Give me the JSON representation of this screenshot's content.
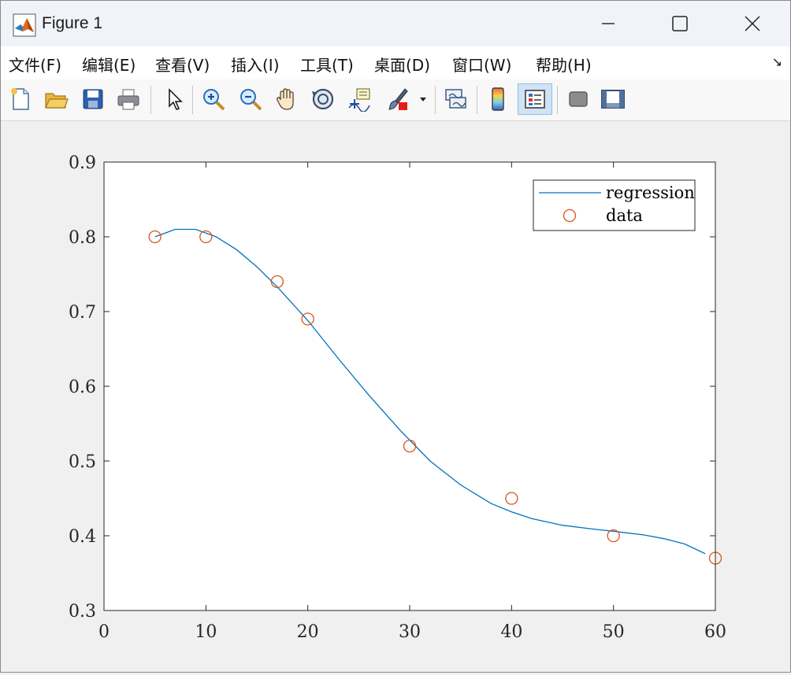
{
  "window": {
    "title": "Figure 1"
  },
  "menu": [
    "文件(F)",
    "编辑(E)",
    "查看(V)",
    "插入(I)",
    "工具(T)",
    "桌面(D)",
    "窗口(W)",
    "帮助(H)"
  ],
  "toolbar": [
    "new-figure",
    "open-file",
    "save",
    "print",
    "select-pointer",
    "zoom-in",
    "zoom-out",
    "pan",
    "rotate-3d",
    "data-cursor",
    "brush",
    "brush-dropdown",
    "link-plot",
    "insert-colorbar",
    "insert-legend",
    "hide-plot-tools",
    "show-plot-tools"
  ],
  "colors": {
    "line": "#0072bd",
    "marker": "#d95319",
    "axes_bg": "#ffffff",
    "figure_bg": "#f0f0f0"
  },
  "chart_data": {
    "type": "line",
    "xlim": [
      0,
      60
    ],
    "ylim": [
      0.3,
      0.9
    ],
    "xticks": [
      "0",
      "10",
      "20",
      "30",
      "40",
      "50",
      "60"
    ],
    "yticks": [
      "0.3",
      "0.4",
      "0.5",
      "0.6",
      "0.7",
      "0.8",
      "0.9"
    ],
    "legend_position": "top-right",
    "series": [
      {
        "name": "regression",
        "style": "line",
        "x": [
          5,
          7,
          9,
          11,
          13,
          15,
          17,
          20,
          23,
          26,
          29,
          32,
          35,
          38,
          40,
          42,
          45,
          48,
          50,
          53,
          55,
          57,
          59
        ],
        "y": [
          0.8,
          0.81,
          0.81,
          0.8,
          0.783,
          0.76,
          0.733,
          0.688,
          0.637,
          0.588,
          0.542,
          0.5,
          0.468,
          0.443,
          0.432,
          0.423,
          0.414,
          0.409,
          0.406,
          0.401,
          0.396,
          0.389,
          0.376
        ]
      },
      {
        "name": "data",
        "style": "marker",
        "x": [
          5,
          10,
          17,
          20,
          30,
          40,
          50,
          60
        ],
        "y": [
          0.8,
          0.8,
          0.74,
          0.69,
          0.52,
          0.45,
          0.4,
          0.37
        ]
      }
    ]
  }
}
